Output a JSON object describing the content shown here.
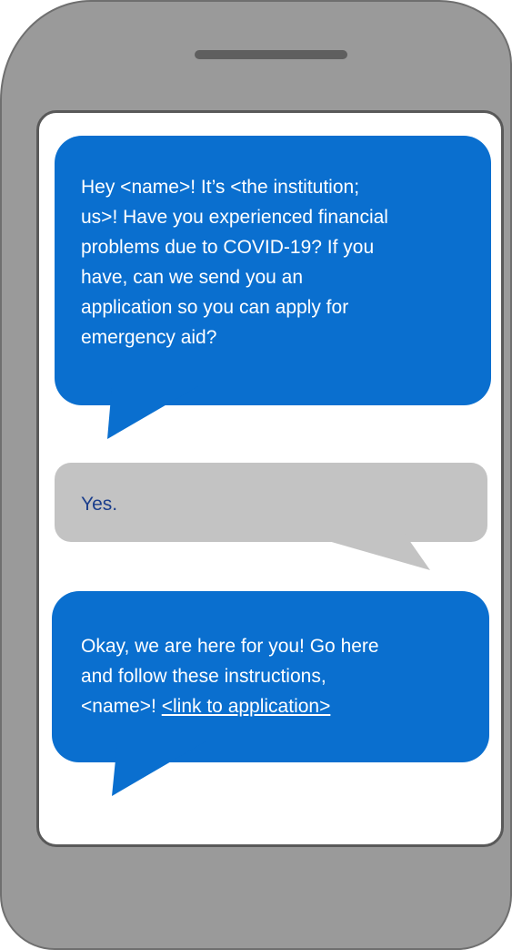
{
  "phone": {
    "speaker_icon": "speaker-grille"
  },
  "conversation": {
    "message_1": {
      "text": "Hey <name>! It’s <the institution;\nus>! Have you experienced financial\nproblems due to COVID-19? If you\nhave, can we send you an\napplication so you can apply for\nemergency aid?",
      "color": "#0a6fcf"
    },
    "reply_1": {
      "text": "Yes.",
      "color": "#c3c3c3",
      "text_color": "#1b3e8c"
    },
    "message_2": {
      "text_before_link": "Okay, we are here for you! Go here\nand follow these instructions,\n<name>! ",
      "link_text": "<link to application>",
      "color": "#0a6fcf"
    }
  }
}
